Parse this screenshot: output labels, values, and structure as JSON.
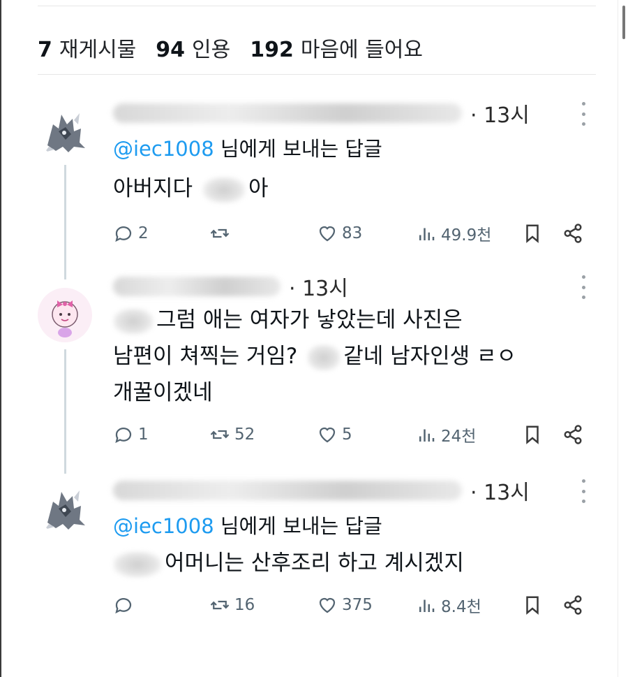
{
  "stats": {
    "reposts_count": "7",
    "reposts_label": "재게시물",
    "quotes_count": "94",
    "quotes_label": "인용",
    "likes_count": "192",
    "likes_label": "마음에 들어요"
  },
  "replies": [
    {
      "time": "· 13시",
      "reply_to_handle": "@iec1008",
      "reply_to_suffix": " 님에게 보내는 답글",
      "text_lines": [
        "아버지다 ",
        "아"
      ],
      "comments": "2",
      "reposts": "",
      "likes": "83",
      "views": "49.9천"
    },
    {
      "time": "· 13시",
      "text_lines": [
        "그럼 애는 여자가 낳았는데 사진은",
        "남편이 쳐찍는 거임? ",
        "같네 남자인생 ㄹㅇ",
        "개꿀이겠네"
      ],
      "comments": "1",
      "reposts": "52",
      "likes": "5",
      "views": "24천"
    },
    {
      "time": "· 13시",
      "reply_to_handle": "@iec1008",
      "reply_to_suffix": " 님에게 보내는 답글",
      "text_lines": [
        "어머니는 산후조리 하고 계시겠지"
      ],
      "comments": "",
      "reposts": "16",
      "likes": "375",
      "views": "8.4천"
    }
  ],
  "icons": {
    "reply": "speech-bubble-icon",
    "repost": "repost-arrows-icon",
    "like": "heart-icon",
    "views": "bar-chart-icon",
    "bookmark": "bookmark-icon",
    "share": "share-icon",
    "more": "more-vertical-icon"
  },
  "colors": {
    "link": "#1d9bf0",
    "meta": "#536471",
    "text": "#0f1419"
  }
}
